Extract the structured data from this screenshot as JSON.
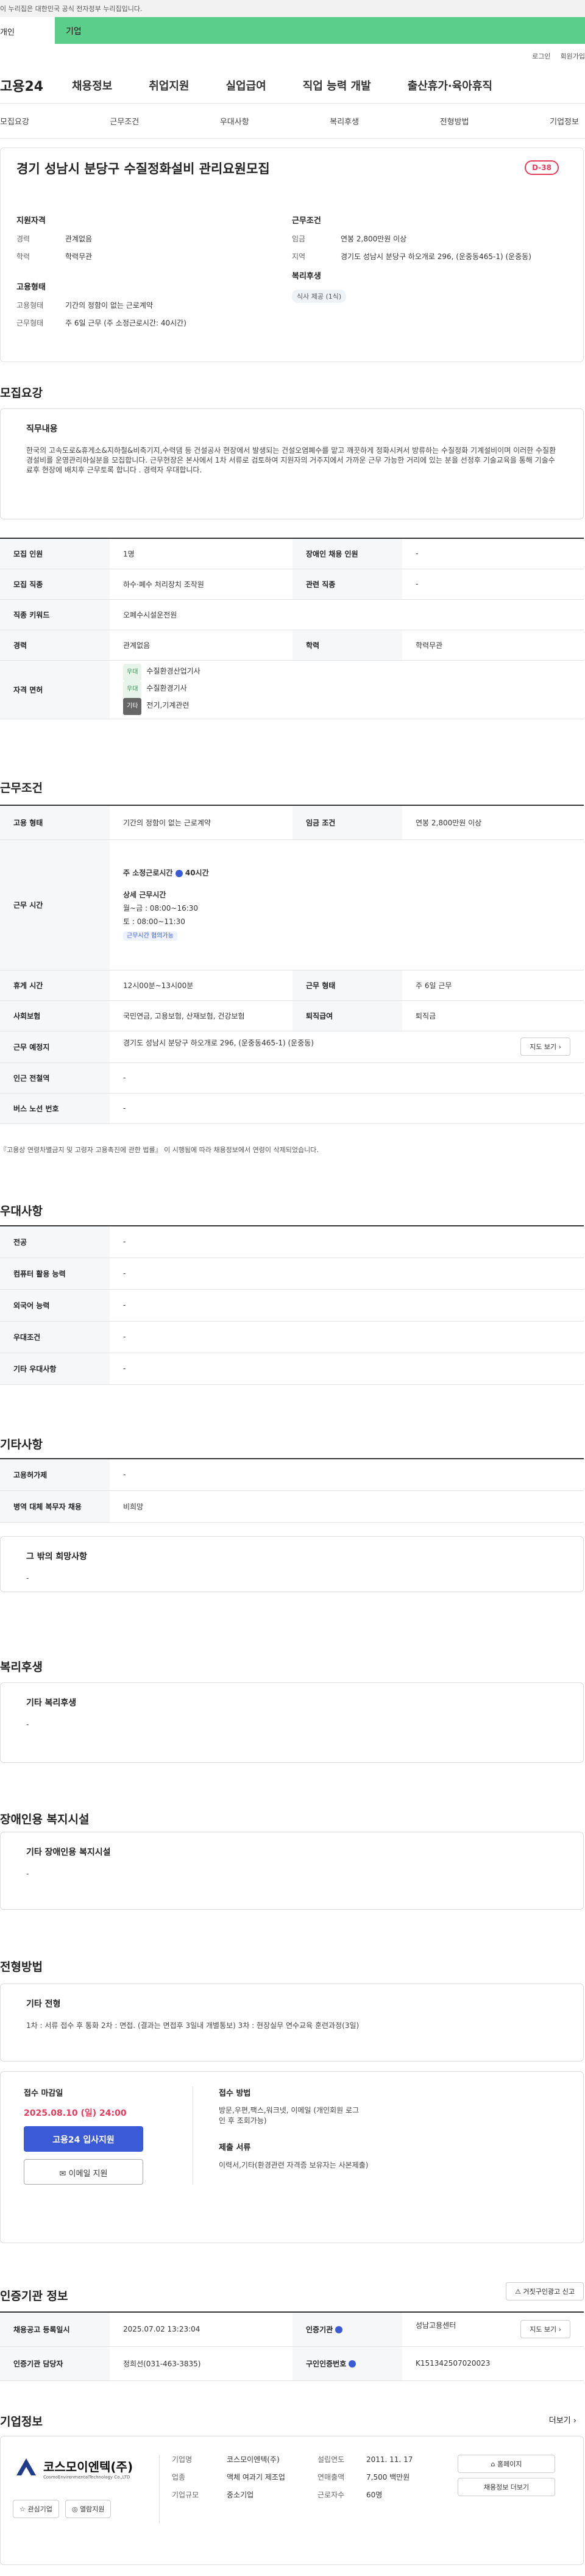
{
  "top": {
    "gov_notice": "이 누리집은 대한민국 공식 전자정부 누리집입니다.",
    "tab_individual": "개인",
    "tab_business": "기업"
  },
  "utility": {
    "login": "로그인",
    "join": "회원가입"
  },
  "gnb": {
    "logo": "고용24",
    "items": [
      "채용정보",
      "취업지원",
      "실업급여",
      "직업 능력 개발",
      "출산휴가·육아휴직"
    ]
  },
  "subnav": [
    "모집요강",
    "근무조건",
    "우대사항",
    "복리후생",
    "전형방법",
    "기업정보"
  ],
  "summary": {
    "title": "경기 성남시 분당구 수질정화설비 관리요원모집",
    "dday": "D-38",
    "qual_h": "지원자격",
    "career_k": "경력",
    "career_v": "관계없음",
    "edu_k": "학력",
    "edu_v": "학력무관",
    "cond_h": "근무조건",
    "wage_k": "임금",
    "wage_v": "연봉 2,800만원 이상",
    "loc_k": "지역",
    "loc_v": "경기도 성남시 분당구 하오개로 296, (운중동465-1) (운중동)",
    "emp_h": "고용형태",
    "emptype_k": "고용형태",
    "emptype_v": "기간의 정함이 없는 근로계약",
    "work_k": "근무형태",
    "work_v": "주 6일 근무 (주 소정근로시간: 40시간)",
    "welfare_h": "복리후생",
    "welfare_chip": "식사 제공 (1식)"
  },
  "recruit": {
    "heading": "모집요강",
    "duty_h": "직무내용",
    "duty_text": "한국의 고속도로&휴게소&지하철&비축기지,수력댐 등 건설공사 현장에서 발생되는 건설오염폐수를 맡고 깨끗하게 정화시켜서 방류하는 수질정화 기계설비이며 이러한 수질환경설비를 운영관리하실분을 모집합니다. 근무현장은 본사에서 1차 서류로 검토하여 지원자의 거주지에서 가까운 근무 가능한 거리에 있는 분을 선정후 기술교육을 통해 기술수료후 현장에 배치후 근무토록 합니다 . 경력자 우대합니다.",
    "hire_count_k": "모집 인원",
    "hire_count_v": "1명",
    "disabled_k": "장애인 채용 인원",
    "disabled_v": "-",
    "job_k": "모집 직종",
    "job_v": "하수·폐수 처리장치 조작원",
    "related_k": "관련 직종",
    "related_v": "-",
    "keyword_k": "직종 키워드",
    "keyword_v": "오폐수시설운전원",
    "career_k": "경력",
    "career_v": "관계없음",
    "edu_k": "학력",
    "edu_v": "학력무관",
    "license_k": "자격 면허",
    "licenses": [
      {
        "tag": "우대",
        "name": "수질환경산업기사"
      },
      {
        "tag": "우대",
        "name": "수질환경기사"
      },
      {
        "tag": "기타",
        "name": "전기,기계관련"
      }
    ]
  },
  "conditions": {
    "heading": "근무조건",
    "emptype_k": "고용 형태",
    "emptype_v": "기간의 정함이 없는 근로계약",
    "wage_k": "임금 조건",
    "wage_v": "연봉 2,800만원 이상",
    "hours_k": "근무 시간",
    "weekly": "주 소정근로시간",
    "weekly_v": "40시간",
    "detail_h": "상세 근무시간",
    "mon_fri": "월~금 : 08:00~16:30",
    "sat": "토 : 08:00~11:30",
    "hours_chip": "근무시간 협의가능",
    "break_k": "휴게 시간",
    "break_v": "12시00분~13시00분",
    "workform_k": "근무 형태",
    "workform_v": "주 6일 근무",
    "insurance_k": "사회보험",
    "insurance_v": "국민연금, 고용보험, 산재보험, 건강보험",
    "severance_k": "퇴직급여",
    "severance_v": "퇴직금",
    "place_k": "근무 예정지",
    "place_v": "경기도 성남시 분당구 하오개로 296, (운중동465-1) (운중동)",
    "map_btn": "지도 보기",
    "subway_k": "인근 전철역",
    "subway_v": "-",
    "bus_k": "버스 노선 번호",
    "bus_v": "-",
    "footnote": "『고용상 연령차별금지 및 고령자 고용촉진에 관한 법률』 이 시행됨에 따라 채용정보에서 연령이 삭제되었습니다."
  },
  "prefer": {
    "heading": "우대사항",
    "rows": [
      {
        "k": "전공",
        "v": "-"
      },
      {
        "k": "컴퓨터 활용 능력",
        "v": "-"
      },
      {
        "k": "외국어 능력",
        "v": "-"
      },
      {
        "k": "우대조건",
        "v": "-"
      },
      {
        "k": "기타 우대사항",
        "v": "-"
      }
    ]
  },
  "etc": {
    "heading": "기타사항",
    "equip_k": "고용허가제",
    "equip_v": "-",
    "military_k": "병역 대체 복무자 채용",
    "military_v": "비희망",
    "other_h": "그 밖의 희망사항",
    "other_v": "-"
  },
  "welfare": {
    "heading": "복리후생",
    "box_h": "기타 복리후생",
    "box_v": "-"
  },
  "disability": {
    "heading": "장애인용 복지시설",
    "box_h": "기타 장애인용 복지시설",
    "box_v": "-"
  },
  "selection": {
    "heading": "전형방법",
    "box_h": "기타 전형",
    "box_v": "1차 : 서류 접수 후 통화 2차 : 면접. (결과는 면접후 3일내 개별통보) 3차 : 현장실무 연수교육 훈련과정(3일)",
    "deadline_h": "접수 마감일",
    "deadline_v": "2025.08.10 (일) 24:00",
    "apply_btn": "고용24 입사지원",
    "email_btn": "이메일 지원",
    "method_h": "접수 방법",
    "method_v": "방문,우편,팩스,워크넷, 이메일 (개인회원 로그인 후 조회가능)",
    "docs_h": "제출 서류",
    "docs_v": "이력서,기타(환경관련 자격증 보유자는 사본제출)"
  },
  "agency": {
    "heading": "인증기관 정보",
    "report_btn": "거짓구인광고 신고",
    "reg_k": "채용공고 등록일시",
    "reg_v": "2025.07.02 13:23:04",
    "agency_k": "인증기관",
    "agency_v": "성남고용센터",
    "map_btn": "지도 보기",
    "contact_k": "인증기관 담당자",
    "contact_v": "정희선(031-463-3835)",
    "id_k": "구인인증번호",
    "id_v": "K151342507020023"
  },
  "company": {
    "heading": "기업정보",
    "more": "더보기",
    "logo_ko": "코스모이엔텍(주)",
    "logo_en": "CosmoEnvironmentalTechnology Co.,LTD",
    "fav_btn": "관심기업",
    "apply_btn": "열람지원",
    "name_k": "기업명",
    "name_v": "코스모이엔텍(주)",
    "industry_k": "업종",
    "industry_v": "액체 여과기 제조업",
    "size_k": "기업규모",
    "size_v": "중소기업",
    "founded_k": "설립연도",
    "founded_v": "2011. 11. 17",
    "sales_k": "연매출액",
    "sales_v": "7,500 백만원",
    "staff_k": "근로자수",
    "staff_v": "60명",
    "home_btn": "홈페이지",
    "other_btn": "채용정보 더보기"
  }
}
